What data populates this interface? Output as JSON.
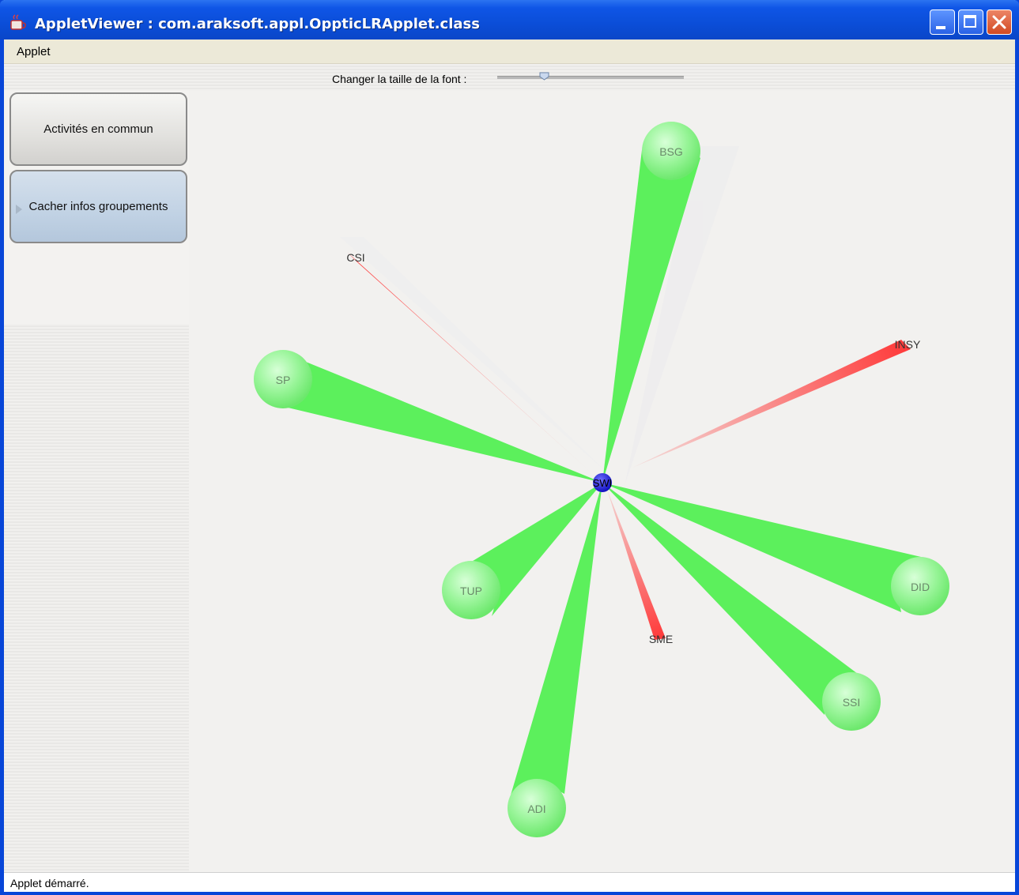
{
  "window": {
    "title": "AppletViewer : com.araksoft.appl.OppticLRApplet.class",
    "accent_color": "#0a4ed8"
  },
  "menubar": {
    "items": [
      "Applet"
    ]
  },
  "toolbar": {
    "font_label": "Changer la taille de la font :",
    "font_slider_fraction": 0.25
  },
  "sidebar": {
    "activites_label": "Activités en commun",
    "cacher_label": "Cacher infos groupements"
  },
  "graph": {
    "center": {
      "label": "SWI",
      "color": "#1010e0"
    },
    "green_color": "#66ff66",
    "red_color": "#ff4444",
    "nodes": [
      {
        "label": "BSG",
        "type": "big"
      },
      {
        "label": "SP",
        "type": "big"
      },
      {
        "label": "TUP",
        "type": "big"
      },
      {
        "label": "ADI",
        "type": "big"
      },
      {
        "label": "DID",
        "type": "big"
      },
      {
        "label": "SSI",
        "type": "big"
      },
      {
        "label": "CSI",
        "type": "small"
      },
      {
        "label": "INSY",
        "type": "small"
      },
      {
        "label": "SME",
        "type": "small"
      }
    ]
  },
  "status": {
    "text": "Applet démarré."
  }
}
